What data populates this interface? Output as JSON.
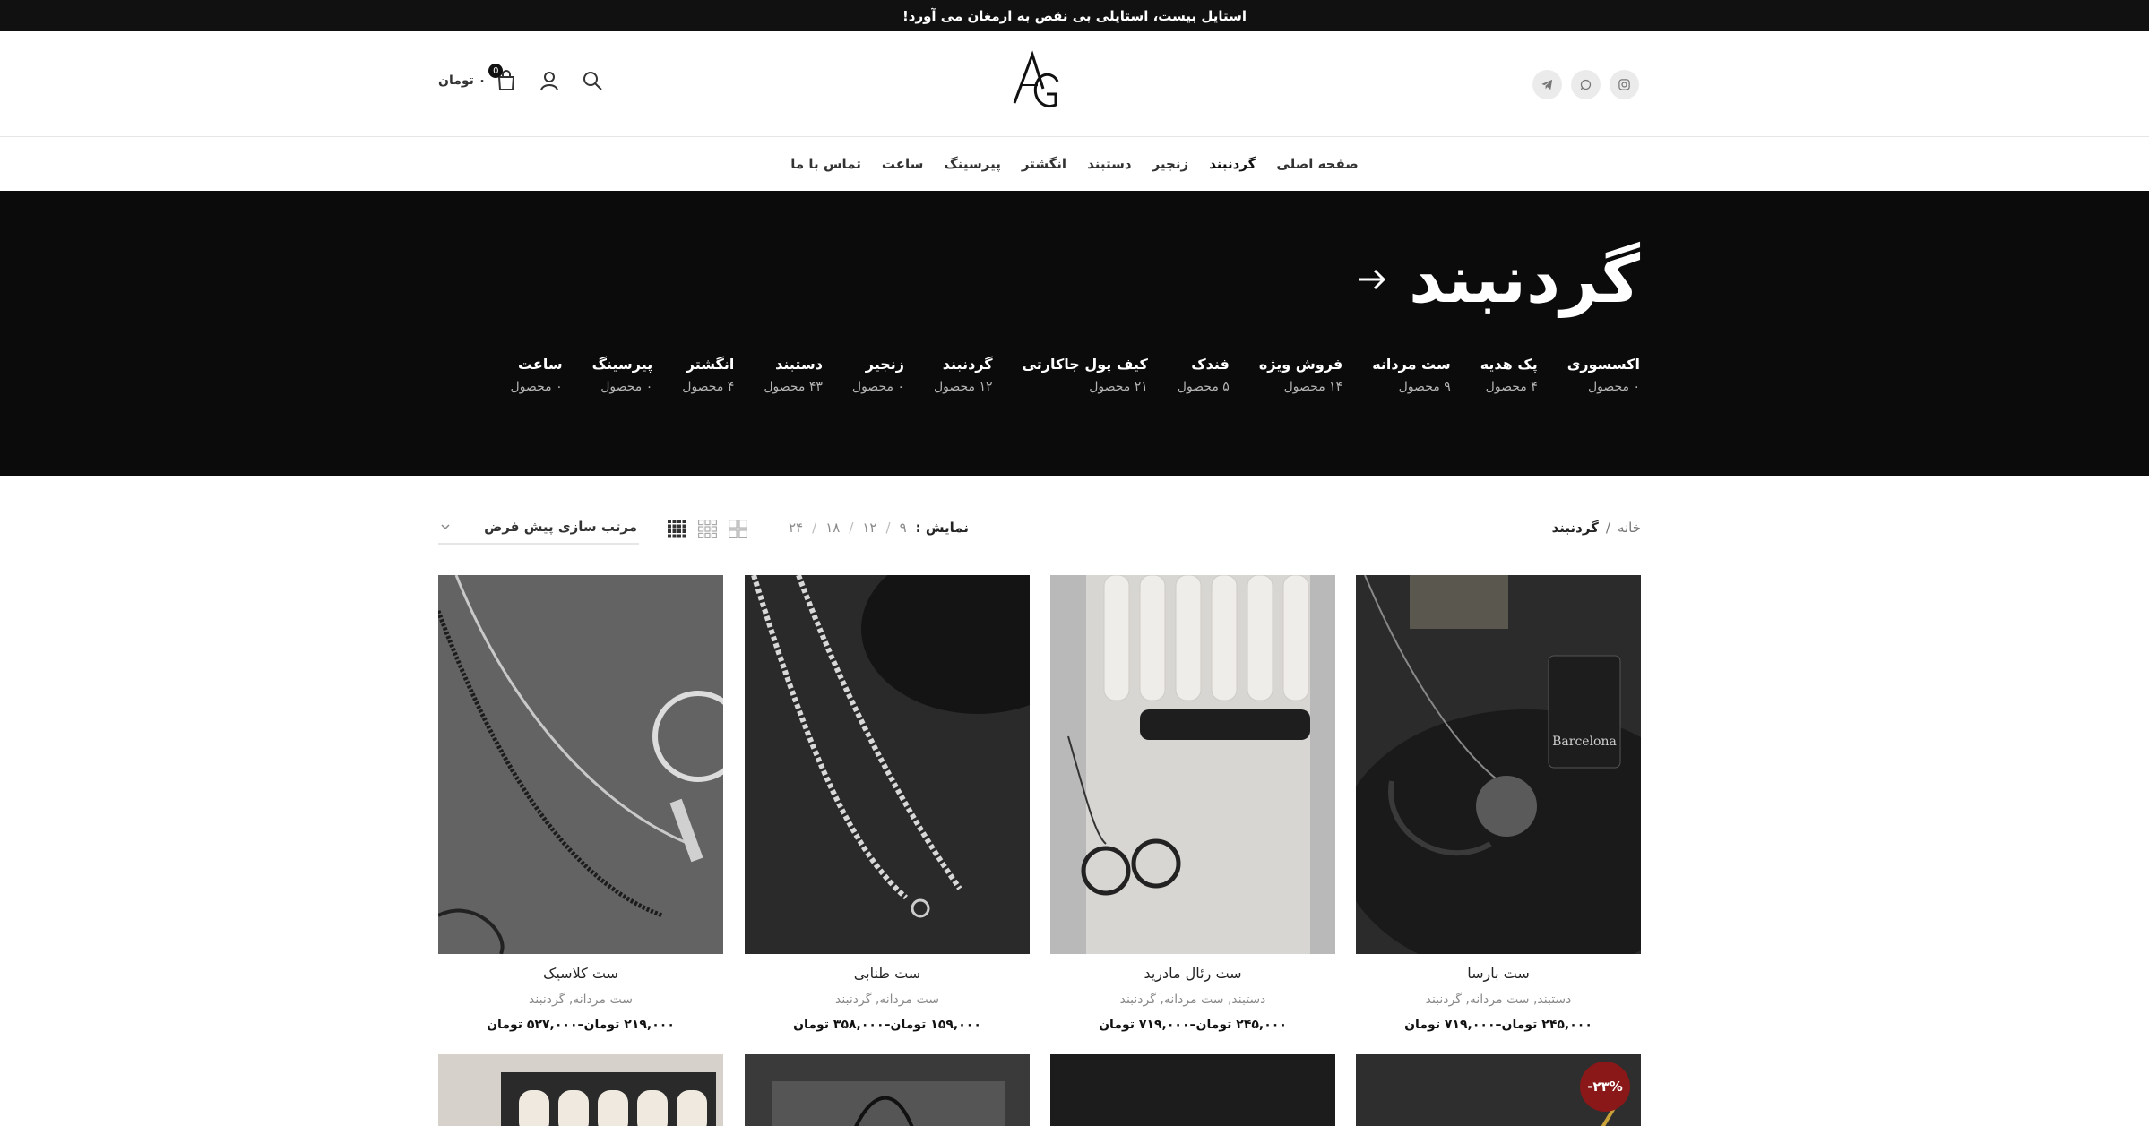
{
  "announcement": "استایل بیست، استایلی بی نقص به ارمغان می آورد!",
  "header": {
    "logo_text": "AG",
    "social_icons": [
      "instagram-icon",
      "whatsapp-icon",
      "telegram-icon"
    ],
    "cart_total": "۰ تومان",
    "cart_count": "0"
  },
  "nav": {
    "items": [
      {
        "label": "صفحه اصلی"
      },
      {
        "label": "گردنبند"
      },
      {
        "label": "زنجیر"
      },
      {
        "label": "دستبند"
      },
      {
        "label": "انگشتر"
      },
      {
        "label": "پیرسینگ"
      },
      {
        "label": "ساعت"
      },
      {
        "label": "تماس با ما"
      }
    ],
    "active_index": 1
  },
  "hero": {
    "title": "گردنبند",
    "categories": [
      {
        "name": "اکسسوری",
        "count": "۰ محصول"
      },
      {
        "name": "پک هدیه",
        "count": "۴ محصول"
      },
      {
        "name": "ست مردانه",
        "count": "۹ محصول"
      },
      {
        "name": "فروش ویژه",
        "count": "۱۴ محصول"
      },
      {
        "name": "فندک",
        "count": "۵ محصول"
      },
      {
        "name": "کیف پول جاکارتی",
        "count": "۲۱ محصول"
      },
      {
        "name": "گردنبند",
        "count": "۱۲ محصول"
      },
      {
        "name": "زنجیر",
        "count": "۰ محصول"
      },
      {
        "name": "دستبند",
        "count": "۴۳ محصول"
      },
      {
        "name": "انگشتر",
        "count": "۴ محصول"
      },
      {
        "name": "پیرسینگ",
        "count": "۰ محصول"
      },
      {
        "name": "ساعت",
        "count": "۰ محصول"
      }
    ]
  },
  "toolbar": {
    "breadcrumb_home": "خانه",
    "breadcrumb_sep": "/",
    "breadcrumb_current": "گردنبند",
    "per_page_label": "نمایش :",
    "per_page_options": [
      "۹",
      "۱۲",
      "۱۸",
      "۲۴"
    ],
    "per_page_sep": "/",
    "sort_label": "مرتب سازی پیش فرض"
  },
  "products": [
    {
      "name": "ست بارسا",
      "categories": "دستبند, ست مردانه, گردنبند",
      "price": "۲۴۵,۰۰۰ تومان–۷۱۹,۰۰۰ تومان"
    },
    {
      "name": "ست رئال مادرید",
      "categories": "دستبند, ست مردانه, گردنبند",
      "price": "۲۴۵,۰۰۰ تومان–۷۱۹,۰۰۰ تومان"
    },
    {
      "name": "ست طنابی",
      "categories": "ست مردانه, گردنبند",
      "price": "۱۵۹,۰۰۰ تومان–۳۵۸,۰۰۰ تومان"
    },
    {
      "name": "ست کلاسیک",
      "categories": "ست مردانه, گردنبند",
      "price": "۲۱۹,۰۰۰ تومان–۵۲۷,۰۰۰ تومان"
    }
  ],
  "second_row_badge": "-۲۳%",
  "colors": {
    "topbar": "#111111",
    "hero": "#0b0b0b",
    "badge": "#8b1818",
    "text": "#242424",
    "muted": "#8a8a8a"
  }
}
